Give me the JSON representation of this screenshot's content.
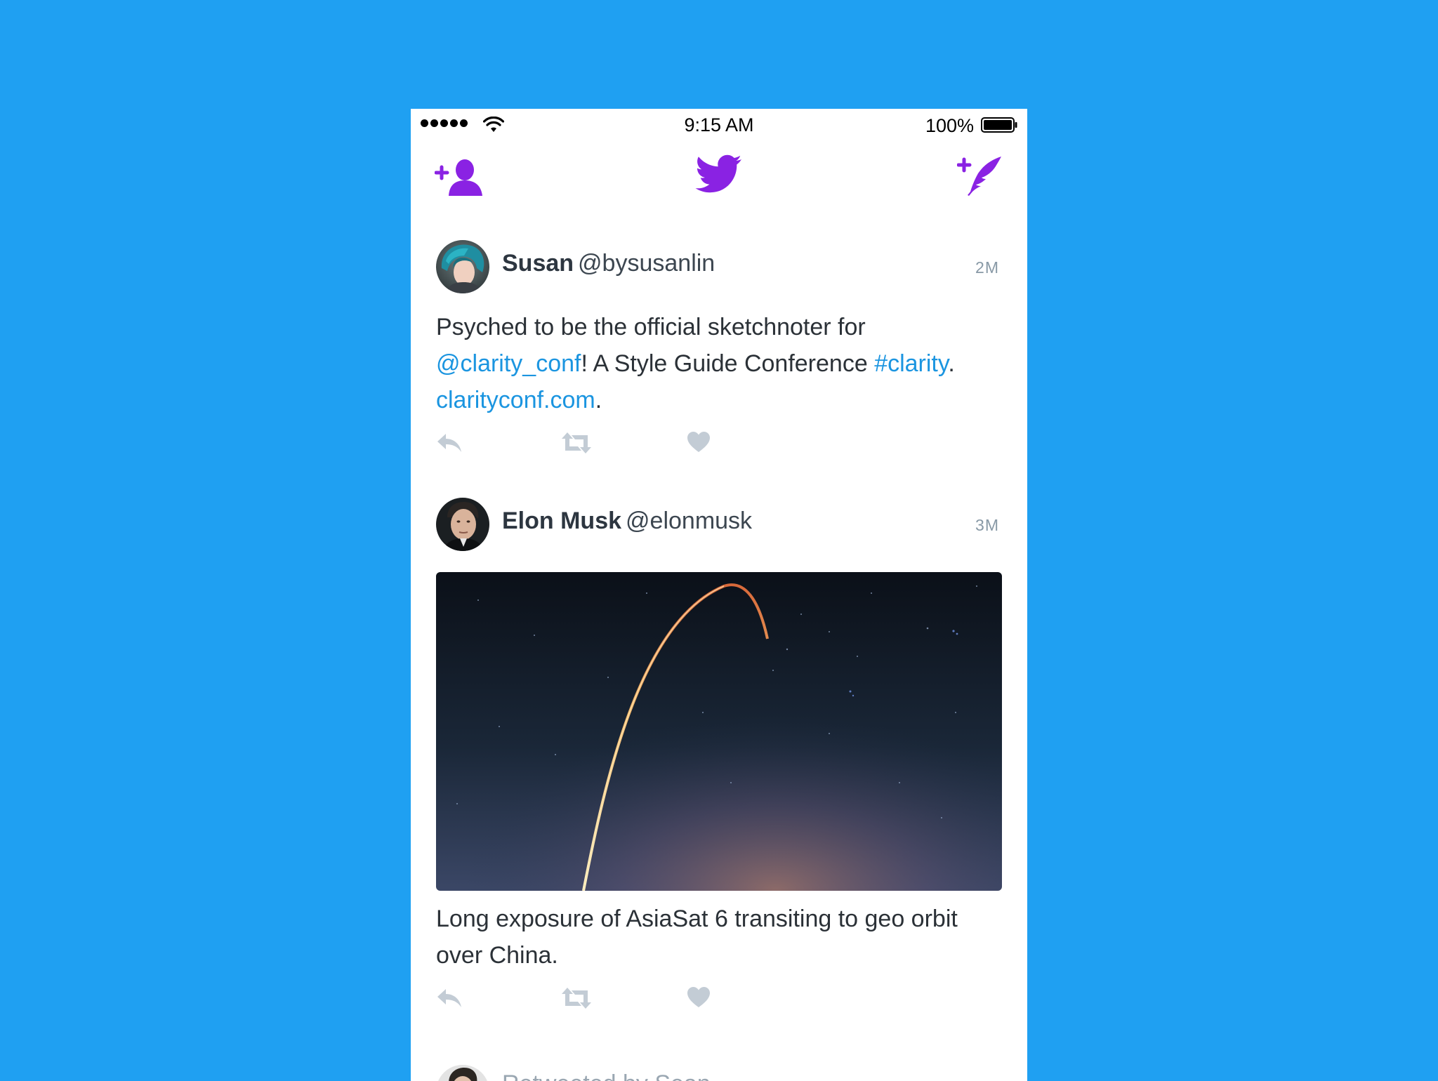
{
  "status_bar": {
    "time": "9:15 AM",
    "battery": "100%"
  },
  "nav": {
    "add_user_icon": "add-user-icon",
    "logo_icon": "twitter-bird-icon",
    "compose_icon": "compose-tweet-icon"
  },
  "colors": {
    "background": "#1fa0f2",
    "accent_purple": "#8a22e3",
    "link_blue": "#1b95e0",
    "action_gray": "#c3ccd5"
  },
  "tweets": [
    {
      "name": "Susan",
      "handle": "@bysusanlin",
      "time": "2M",
      "text_parts": [
        "Psyched to be the official sketchnoter for",
        "@clarity_conf",
        "! A Style Guide Conference ",
        "#clarity",
        ".",
        "clarityconf.com",
        "."
      ]
    },
    {
      "name": "Elon Musk",
      "handle": "@elonmusk",
      "time": "3M",
      "text_parts": [
        "Long exposure of AsiaSat 6 transiting to geo orbit",
        "over China."
      ]
    }
  ],
  "retweet": {
    "label": "Retweeted by Sean"
  }
}
